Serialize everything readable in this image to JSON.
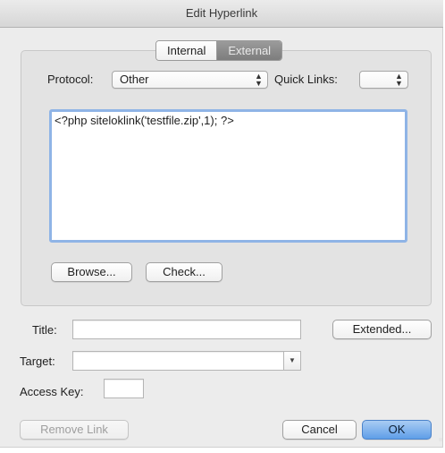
{
  "window": {
    "title": "Edit Hyperlink"
  },
  "tabs": [
    {
      "label": "Internal",
      "selected": false
    },
    {
      "label": "External",
      "selected": true
    }
  ],
  "protocol": {
    "label": "Protocol:",
    "selected": "Other"
  },
  "quick_links": {
    "label": "Quick Links:",
    "selected": ""
  },
  "link_text": "<?php siteloklink('testfile.zip',1); ?>",
  "buttons": {
    "browse": "Browse...",
    "check": "Check...",
    "extended": "Extended...",
    "remove_link": "Remove Link",
    "cancel": "Cancel",
    "ok": "OK"
  },
  "fields": {
    "title_label": "Title:",
    "title_value": "",
    "target_label": "Target:",
    "target_value": "",
    "access_key_label": "Access Key:",
    "access_key_value": ""
  },
  "colors": {
    "selection_ring": "#8fb4e6",
    "primary_button": "#5f9ee8",
    "selected_segment": "#8a8a8a"
  }
}
